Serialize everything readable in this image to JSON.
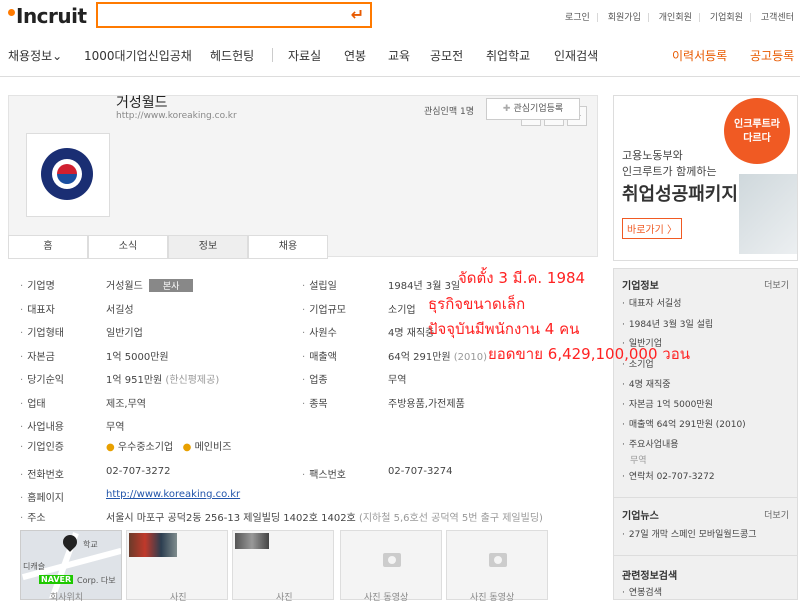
{
  "header": {
    "logo": "Incruit",
    "search_arrow": "↵",
    "links": [
      "로그인",
      "회원가입",
      "개인회원",
      "기업회원",
      "고객센터"
    ]
  },
  "nav": {
    "items": [
      "채용정보⌄",
      "1000대기업신입공채",
      "헤드헌팅",
      "자료실",
      "연봉",
      "교육",
      "공모전",
      "취업학교",
      "인재검색"
    ],
    "right": [
      "이력서등록",
      "공고등록"
    ]
  },
  "company": {
    "name": "거성월드",
    "url": "http://www.koreaking.co.kr",
    "followers": "관심인맥 1명",
    "fav_button": "관심기업등록",
    "logo_text": "KOREA KING",
    "social": [
      "t",
      "f",
      "+"
    ]
  },
  "tabs": [
    "홈",
    "소식",
    "정보",
    "채용"
  ],
  "info": {
    "name_label": "기업명",
    "name_value": "거성월드",
    "hq_badge": "본사",
    "ceo_label": "대표자",
    "ceo_value": "서길성",
    "type_label": "기업형태",
    "type_value": "일반기업",
    "capital_label": "자본금",
    "capital_value": "1억 5000만원",
    "profit_label": "당기순익",
    "profit_value": "1억 951만원",
    "profit_note": "(한신평제공)",
    "biz_label": "업태",
    "biz_value": "제조,무역",
    "content_label": "사업내용",
    "content_value": "무역",
    "cert_label": "기업인증",
    "cert_1": "우수중소기업",
    "cert_2": "메인비즈",
    "founded_label": "설립일",
    "founded_value": "1984년 3월 3일",
    "scale_label": "기업규모",
    "scale_value": "소기업",
    "staff_label": "사원수",
    "staff_value": "4명 재직중",
    "sales_label": "매출액",
    "sales_value": "64억 291만원",
    "sales_year": "(2010)",
    "industry_label": "업종",
    "industry_value": "무역",
    "item_label": "종목",
    "item_value": "주방용품,가전제품",
    "phone_label": "전화번호",
    "phone_value": "02-707-3272",
    "fax_label": "팩스번호",
    "fax_value": "02-707-3274",
    "home_label": "홈페이지",
    "home_value": "http://www.koreaking.co.kr",
    "addr_label": "주소",
    "addr_value": "서울시 마포구 공덕2동 256-13 제일빌딩 1402호 1402호",
    "addr_note": "(지하철 5,6호선 공덕역 5번 출구 제일빌딩)"
  },
  "gallery": {
    "map_label1": "학교",
    "map_label2": "디캐슬",
    "naver": "NAVER",
    "map_corp": "Corp. 다보",
    "captions": [
      "회사위치",
      "사진",
      "사진",
      "사진 동영상",
      "사진 동영상"
    ]
  },
  "ad": {
    "bubble": "인크루트라\n다르다",
    "line1": "고용노동부와",
    "line2": "인크루트가 함께하는",
    "big_pre": "취업성공패키지",
    "go": "바로가기 〉"
  },
  "side": {
    "info_title": "기업정보",
    "more": "더보기",
    "items": [
      "대표자 서길성",
      "1984년 3월 3일 설립",
      "일반기업",
      "소기업",
      "4명 재직중",
      "자본금 1억 5000만원",
      "매출액 64억 291만원 (2010)",
      "주요사업내용"
    ],
    "sub": "무역",
    "contact": "연락처 02-707-3272",
    "news_title": "기업뉴스",
    "news_more": "더보기",
    "news_item": "27일 개막 스페인 모바일월드콩그",
    "related_title": "관련정보검색",
    "related_item": "연봉검색"
  },
  "overlay": {
    "line1": "จัดตั้ง 3 มี.ค. 1984",
    "line2": "ธุรกิจขนาดเล็ก",
    "line3": "ปัจจุบันมีพนักงาน 4 คน",
    "line4": "ยอดขาย 6,429,100,000 วอน"
  },
  "colors": {
    "accent": "#ff7a00",
    "ad_orange": "#f05a23",
    "overlay": "#ff2222"
  }
}
